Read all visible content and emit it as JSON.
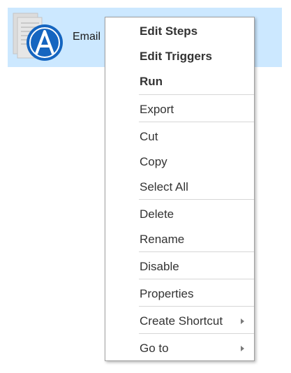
{
  "file_item": {
    "label": "Email",
    "icon": "document-with-automation-badge-icon"
  },
  "context_menu": {
    "edit_steps": "Edit Steps",
    "edit_triggers": "Edit Triggers",
    "run": "Run",
    "export": "Export",
    "cut": "Cut",
    "copy": "Copy",
    "select_all": "Select All",
    "delete": "Delete",
    "rename": "Rename",
    "disable": "Disable",
    "properties": "Properties",
    "create_shortcut": "Create Shortcut",
    "go_to": "Go to"
  },
  "colors": {
    "selection": "#cce8ff",
    "badge_blue": "#1565c0"
  }
}
